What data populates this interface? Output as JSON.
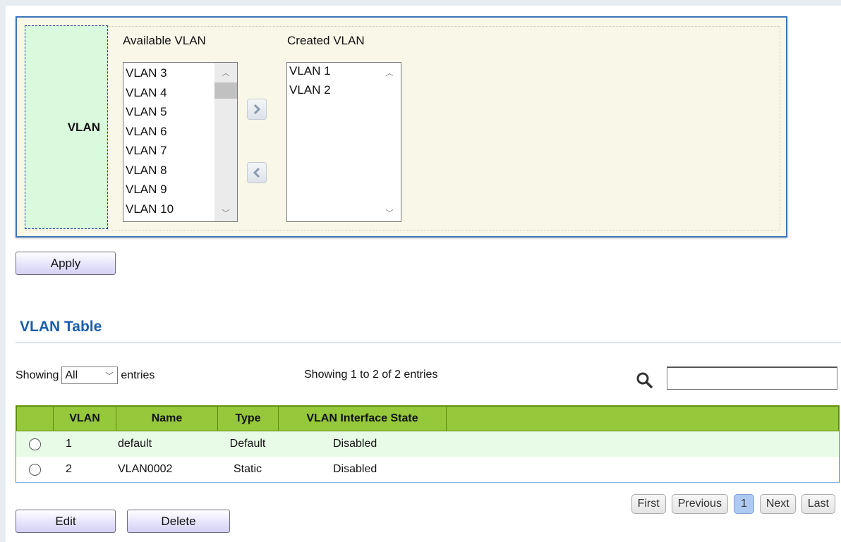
{
  "vlan_panel": {
    "label": "VLAN",
    "available_title": "Available VLAN",
    "created_title": "Created VLAN",
    "available_items": [
      "VLAN 3",
      "VLAN 4",
      "VLAN 5",
      "VLAN 6",
      "VLAN 7",
      "VLAN 8",
      "VLAN 9",
      "VLAN 10"
    ],
    "created_items": [
      "VLAN 1",
      "VLAN 2"
    ],
    "move_right_icon": "chevron-right-icon",
    "move_left_icon": "chevron-left-icon"
  },
  "actions": {
    "apply_label": "Apply",
    "edit_label": "Edit",
    "delete_label": "Delete"
  },
  "vlan_table": {
    "title": "VLAN Table",
    "showing_prefix": "Showing",
    "page_size_selected": "All",
    "showing_suffix": "entries",
    "summary": "Showing 1 to 2 of 2 entries",
    "search_icon": "search-icon",
    "search_value": "",
    "columns": [
      "",
      "VLAN",
      "Name",
      "Type",
      "VLAN Interface State"
    ],
    "rows": [
      {
        "vlan": "1",
        "name": "default",
        "type": "Default",
        "state": "Disabled"
      },
      {
        "vlan": "2",
        "name": "VLAN0002",
        "type": "Static",
        "state": "Disabled"
      }
    ],
    "header_color": "#95c83a",
    "title_color": "#1a5fae"
  },
  "pagination": {
    "first": "First",
    "previous": "Previous",
    "current": "1",
    "next": "Next",
    "last": "Last"
  }
}
